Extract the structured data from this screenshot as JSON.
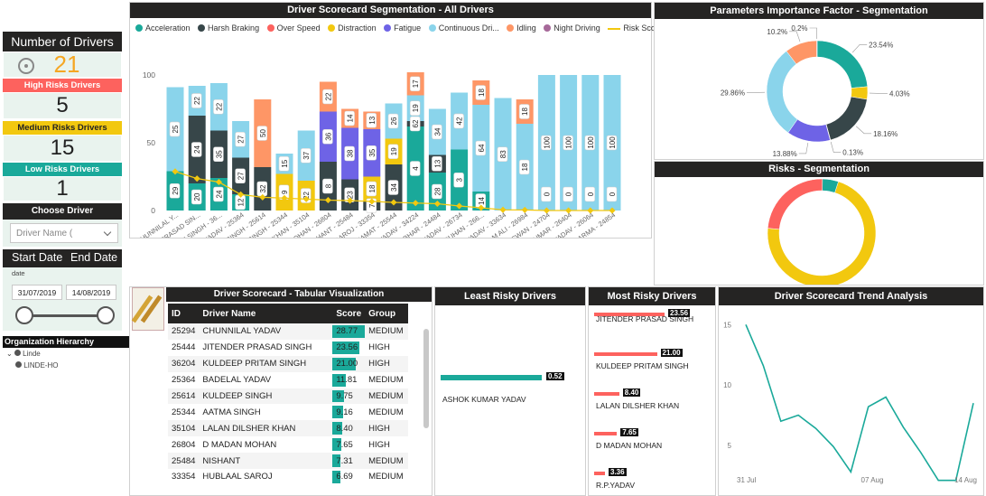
{
  "kpi": {
    "number_of_drivers_title": "Number of Drivers",
    "number_of_drivers": "21",
    "high_label": "High Risks Drivers",
    "high_value": "5",
    "medium_label": "Medium Risks Drivers",
    "medium_value": "15",
    "low_label": "Low Risks Drivers",
    "low_value": "1"
  },
  "choose_driver": {
    "title": "Choose Driver",
    "placeholder": "Driver Name ("
  },
  "dates": {
    "start_label": "Start Date",
    "end_label": "End Date",
    "sub_label": "date",
    "start_value": "31/07/2019",
    "end_value": "14/08/2019"
  },
  "org": {
    "title": "Organization Hierarchy",
    "items": [
      "Linde",
      "LINDE-HO"
    ]
  },
  "segmentation": {
    "title": "Driver Scorecard Segmentation - All Drivers",
    "legend": [
      "Acceleration",
      "Harsh Braking",
      "Over Speed",
      "Distraction",
      "Fatigue",
      "Continuous Dri...",
      "Idling",
      "Night Driving",
      "Risk Score"
    ]
  },
  "colors": {
    "acceleration": "#1aa99a",
    "harsh_braking": "#374649",
    "over_speed": "#fd625e",
    "distraction": "#f2c80f",
    "fatigue": "#6e63e6",
    "continuous": "#8ad4eb",
    "idling": "#fe9666",
    "night": "#a66999",
    "score_line": "#f2c80f",
    "accent": "#f5a623"
  },
  "chart_data": [
    {
      "type": "bar",
      "title": "Driver Scorecard Segmentation - All Drivers",
      "ylim": [
        0,
        100
      ],
      "yticks": [
        "0",
        "50",
        "100"
      ],
      "categories": [
        "CHUNNILAL Y...",
        "JITENDER PRASAD SIN...",
        "KULDEEP PRITAM SINGH - 36...",
        "BADELAL YADAV - 25364",
        "KULDEEP SINGH - 25614",
        "AATMA SINGH - 25344",
        "LALAN DILSHER KHAN - 35104",
        "D MADAN MOHAN - 26804",
        "NISHANT - 25484",
        "HUBLAAL SAROJ - 33354",
        "RAMUDGGAR KAMAT - 25544",
        "R.P.YADAV - 34224",
        "DINESH RAJBHAR - 24484",
        "MAHESH YADAV - 26734",
        "DURG VIJAY CHOUHAN - 266...",
        "ASHOK KUMAR YADAV - 33634",
        "M M ALI - 26984",
        "RAMANUJ PASWAN - 24704",
        "AJAY KUMAR - 26404",
        "MOHIT YADAV - 26064",
        "PANKAJ SHARMA - 24854"
      ],
      "series": [
        {
          "name": "Acceleration",
          "values": [
            29,
            20,
            24,
            12,
            0,
            0,
            0,
            0,
            0,
            0,
            0,
            62,
            28,
            45,
            14,
            0,
            0,
            0,
            0,
            0,
            0
          ]
        },
        {
          "name": "Harsh Braking",
          "values": [
            0,
            50,
            35,
            27,
            32,
            0,
            0,
            36,
            23,
            7,
            34,
            4,
            13,
            0,
            0,
            0,
            0,
            0,
            0,
            0,
            0
          ]
        },
        {
          "name": "Over Speed",
          "values": [
            0,
            0,
            0,
            0,
            0,
            0,
            0,
            0,
            0,
            0,
            0,
            0,
            0,
            0,
            0,
            0,
            0,
            0,
            0,
            0,
            0
          ]
        },
        {
          "name": "Distraction",
          "values": [
            0,
            0,
            0,
            0,
            0,
            27,
            22,
            0,
            0,
            18,
            19,
            0,
            0,
            0,
            0,
            0,
            0,
            0,
            0,
            0,
            0
          ]
        },
        {
          "name": "Fatigue",
          "values": [
            0,
            0,
            0,
            0,
            0,
            0,
            0,
            37,
            38,
            35,
            0,
            0,
            0,
            0,
            0,
            0,
            0,
            0,
            0,
            0,
            0
          ]
        },
        {
          "name": "Continuous Dri...",
          "values": [
            62,
            22,
            35,
            27,
            0,
            15,
            37,
            0,
            0,
            0,
            26,
            19,
            34,
            42,
            64,
            83,
            64,
            100,
            100,
            100,
            100
          ]
        },
        {
          "name": "Idling",
          "values": [
            0,
            0,
            0,
            0,
            50,
            0,
            0,
            22,
            14,
            13,
            0,
            17,
            0,
            0,
            18,
            0,
            18,
            0,
            0,
            0,
            0
          ]
        },
        {
          "name": "Night Driving",
          "values": [
            0,
            0,
            0,
            0,
            0,
            0,
            0,
            0,
            0,
            0,
            0,
            0,
            0,
            0,
            0,
            0,
            0,
            0,
            0,
            0,
            0
          ]
        }
      ],
      "data_labels": [
        [
          "29",
          "62",
          "25"
        ],
        [
          "20",
          "24",
          "50",
          "22"
        ],
        [
          "24",
          "35",
          "22"
        ],
        [
          "12",
          "27",
          "27"
        ],
        [
          "32",
          "50"
        ],
        [
          "9",
          "27",
          "15"
        ],
        [
          "22",
          "37"
        ],
        [
          "8",
          "36",
          "22"
        ],
        [
          "23",
          "38",
          "14"
        ],
        [
          "7",
          "18",
          "35",
          "13"
        ],
        [
          "34",
          "19",
          "26"
        ],
        [
          "4",
          "62",
          "19",
          "17"
        ],
        [
          "28",
          "13",
          "34"
        ],
        [
          "3",
          "45",
          "42"
        ],
        [
          "14",
          "64",
          "18"
        ],
        [
          "1",
          "83"
        ],
        [
          "18",
          "64",
          "18"
        ],
        [
          "0",
          "100"
        ],
        [
          "0",
          "100"
        ],
        [
          "0",
          "100"
        ],
        [
          "0",
          "100"
        ]
      ],
      "risk_score": [
        28.77,
        23.56,
        21.0,
        11.81,
        9.75,
        9.16,
        8.4,
        7.65,
        7.31,
        6.69,
        6.0,
        5.5,
        5.0,
        3.36,
        2.0,
        0.52,
        0.4,
        0.0,
        0.0,
        0.0,
        0.0
      ]
    },
    {
      "type": "pie",
      "title": "Parameters Importance Factor - Segmentation",
      "labels": [
        "Acceleration",
        "Harsh Braking",
        "Over Speed",
        "Distraction",
        "Fatigue",
        "Continuous Dri...",
        "Idling",
        "Night Driving"
      ],
      "values": [
        23.54,
        18.16,
        0.2,
        4.03,
        13.88,
        29.86,
        10.2,
        0.13
      ],
      "slice_labels": [
        "23.54%",
        "18.16%",
        "0.2%",
        "4.03%",
        "13.88%",
        "29.86%",
        "10.2%",
        "0.13%"
      ]
    },
    {
      "type": "pie",
      "title": "Risks - Segmentation",
      "labels": [
        "Medium",
        "High",
        "Low"
      ],
      "values": [
        71.43,
        23.81,
        4.76
      ]
    },
    {
      "type": "bar",
      "title": "Least Risky Drivers",
      "categories": [
        "ASHOK KUMAR YADAV"
      ],
      "values": [
        0.52
      ]
    },
    {
      "type": "bar",
      "title": "Most Risky Drivers",
      "categories": [
        "JITENDER PRASAD SINGH",
        "KULDEEP PRITAM SINGH",
        "LALAN DILSHER KHAN",
        "D MADAN MOHAN",
        "R.P.YADAV"
      ],
      "values": [
        23.56,
        21.0,
        8.4,
        7.65,
        3.36
      ]
    },
    {
      "type": "line",
      "title": "Driver Scorecard Trend Analysis",
      "x_labels": [
        "31 Jul",
        "07 Aug",
        "14 Aug"
      ],
      "y_ticks": [
        "5",
        "10",
        "15"
      ],
      "ylim": [
        2,
        16
      ],
      "values": [
        15.0,
        11.6,
        7.0,
        7.5,
        6.4,
        4.9,
        2.8,
        8.2,
        9.0,
        6.5,
        4.4,
        2.1,
        2.1,
        8.5
      ]
    }
  ],
  "tabular": {
    "title": "Driver Scorecard - Tabular Visualization",
    "columns": [
      "ID",
      "Driver Name",
      "Score",
      "Group"
    ],
    "rows": [
      {
        "id": "25294",
        "name": "CHUNNILAL YADAV",
        "score": "28.77",
        "group": "MEDIUM",
        "pct": 1.0
      },
      {
        "id": "25444",
        "name": "JITENDER PRASAD SINGH",
        "score": "23.56",
        "group": "HIGH",
        "pct": 0.82
      },
      {
        "id": "36204",
        "name": "KULDEEP PRITAM SINGH",
        "score": "21.00",
        "group": "HIGH",
        "pct": 0.73
      },
      {
        "id": "25364",
        "name": "BADELAL YADAV",
        "score": "11.81",
        "group": "MEDIUM",
        "pct": 0.41
      },
      {
        "id": "25614",
        "name": "KULDEEP SINGH",
        "score": "9.75",
        "group": "MEDIUM",
        "pct": 0.34
      },
      {
        "id": "25344",
        "name": "AATMA SINGH",
        "score": "9.16",
        "group": "MEDIUM",
        "pct": 0.32
      },
      {
        "id": "35104",
        "name": "LALAN DILSHER KHAN",
        "score": "8.40",
        "group": "HIGH",
        "pct": 0.29
      },
      {
        "id": "26804",
        "name": "D MADAN MOHAN",
        "score": "7.65",
        "group": "HIGH",
        "pct": 0.27
      },
      {
        "id": "25484",
        "name": "NISHANT",
        "score": "7.31",
        "group": "MEDIUM",
        "pct": 0.25
      },
      {
        "id": "33354",
        "name": "HUBLAAL SAROJ",
        "score": "6.69",
        "group": "MEDIUM",
        "pct": 0.23
      }
    ]
  },
  "panels": {
    "importance_title": "Parameters Importance Factor - Segmentation",
    "risks_title": "Risks - Segmentation",
    "least_title": "Least Risky Drivers",
    "most_title": "Most Risky Drivers",
    "trend_title": "Driver Scorecard Trend Analysis"
  },
  "least": {
    "name": "ASHOK KUMAR YADAV",
    "value": "0.52"
  },
  "most": [
    {
      "name": "JITENDER PRASAD SINGH",
      "value": "23.56"
    },
    {
      "name": "KULDEEP PRITAM SINGH",
      "value": "21.00"
    },
    {
      "name": "LALAN DILSHER KHAN",
      "value": "8.40"
    },
    {
      "name": "D MADAN MOHAN",
      "value": "7.65"
    },
    {
      "name": "R.P.YADAV",
      "value": "3.36"
    }
  ]
}
